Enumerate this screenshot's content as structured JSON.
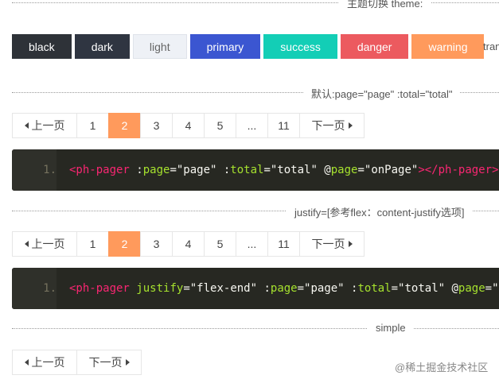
{
  "theme_section": {
    "label": "主题切换 theme:",
    "buttons": [
      {
        "label": "black",
        "bg": "#2e3238",
        "color": "#ffffff"
      },
      {
        "label": "dark",
        "bg": "#2f3541",
        "color": "#ffffff"
      },
      {
        "label": "light",
        "bg": "#eef1f6",
        "color": "#666666"
      },
      {
        "label": "primary",
        "bg": "#3b56d1",
        "color": "#ffffff"
      },
      {
        "label": "success",
        "bg": "#13ceb6",
        "color": "#ffffff"
      },
      {
        "label": "danger",
        "bg": "#ec5a5f",
        "color": "#ffffff"
      },
      {
        "label": "warning",
        "bg": "#ff9a5c",
        "color": "#ffffff"
      }
    ],
    "trailing": "tran"
  },
  "default_section": {
    "label": "默认:page=\"page\" :total=\"total\"",
    "pager": {
      "prev": "上一页",
      "pages": [
        "1",
        "2",
        "3",
        "4",
        "5",
        "...",
        "11"
      ],
      "active": "2",
      "next": "下一页"
    },
    "code": {
      "line_number": "1.",
      "tokens": [
        {
          "t": "<ph-pager",
          "c": "tag"
        },
        {
          "t": " :",
          "c": "str"
        },
        {
          "t": "page",
          "c": "attr"
        },
        {
          "t": "=\"page\" :",
          "c": "str"
        },
        {
          "t": "total",
          "c": "attr"
        },
        {
          "t": "=\"total\" @",
          "c": "str"
        },
        {
          "t": "page",
          "c": "attr"
        },
        {
          "t": "=\"onPage\"",
          "c": "str"
        },
        {
          "t": "></ph-pager>",
          "c": "tag"
        }
      ]
    }
  },
  "justify_section": {
    "label": "justify=[参考flex：content-justify选项]",
    "pager": {
      "prev": "上一页",
      "pages": [
        "1",
        "2",
        "3",
        "4",
        "5",
        "...",
        "11"
      ],
      "active": "2",
      "next": "下一页"
    },
    "code": {
      "line_number": "1.",
      "tokens": [
        {
          "t": "<ph-pager",
          "c": "tag"
        },
        {
          "t": " ",
          "c": "str"
        },
        {
          "t": "justify",
          "c": "attr"
        },
        {
          "t": "=\"flex-end\" :",
          "c": "str"
        },
        {
          "t": "page",
          "c": "attr"
        },
        {
          "t": "=\"page\" :",
          "c": "str"
        },
        {
          "t": "total",
          "c": "attr"
        },
        {
          "t": "=\"total\" @",
          "c": "str"
        },
        {
          "t": "page",
          "c": "attr"
        },
        {
          "t": "=\"o",
          "c": "str"
        }
      ]
    }
  },
  "simple_section": {
    "label": "simple",
    "pager": {
      "prev": "上一页",
      "next": "下一页"
    }
  },
  "watermark": "@稀土掘金技术社区"
}
